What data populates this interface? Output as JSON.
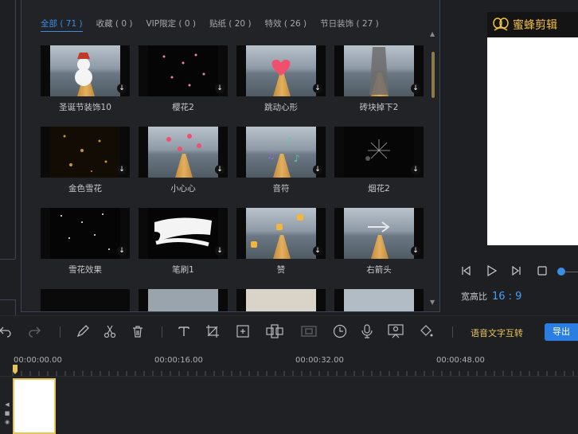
{
  "tabs": [
    {
      "label": "全部 ( 71 )",
      "active": true
    },
    {
      "label": "收藏 ( 0 )",
      "active": false
    },
    {
      "label": "VIP限定 ( 0 )",
      "active": false
    },
    {
      "label": "贴纸 ( 20 )",
      "active": false
    },
    {
      "label": "特效 ( 26 )",
      "active": false
    },
    {
      "label": "节日装饰 ( 27 )",
      "active": false
    }
  ],
  "items": [
    {
      "label": "圣诞节装饰10",
      "style": "snowman"
    },
    {
      "label": "樱花2",
      "style": "dark-petals"
    },
    {
      "label": "跳动心形",
      "style": "heart"
    },
    {
      "label": "砖块掉下2",
      "style": "bricks"
    },
    {
      "label": "金色雪花",
      "style": "gold-sparkle"
    },
    {
      "label": "小心心",
      "style": "hearts"
    },
    {
      "label": "音符",
      "style": "notes"
    },
    {
      "label": "烟花2",
      "style": "fireworks"
    },
    {
      "label": "雪花效果",
      "style": "snow"
    },
    {
      "label": "笔刷1",
      "style": "brush"
    },
    {
      "label": "赞",
      "style": "likes"
    },
    {
      "label": "右箭头",
      "style": "arrow"
    }
  ],
  "preview": {
    "logo_text": "蜜蜂剪辑",
    "ratio_label": "宽高比",
    "ratio_value": "16 : 9"
  },
  "toolbar": {
    "speech_to_text": "语音文字互转",
    "export": "导出"
  },
  "timeline": {
    "marks": [
      "00:00:00.00",
      "00:00:16.00",
      "00:00:32.00",
      "00:00:48.00"
    ]
  },
  "colors": {
    "accent": "#3a8ee6",
    "gold": "#e8c45a",
    "background": "#1e1f23"
  }
}
